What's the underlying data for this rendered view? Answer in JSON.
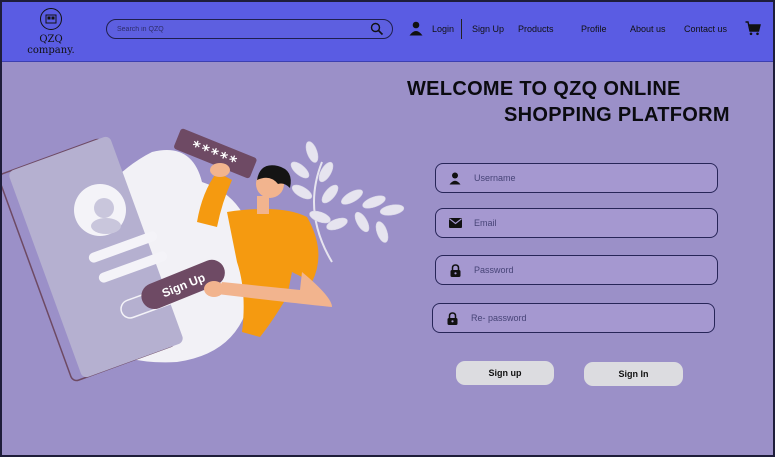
{
  "header": {
    "brand": "QZQ company.",
    "search_placeholder": "Search in QZQ",
    "nav": {
      "login": "Login",
      "signup": "Sign Up",
      "products": "Products",
      "profile": "Profile",
      "about": "About us",
      "contact": "Contact us"
    }
  },
  "hero": {
    "title_line1": "WELCOME TO QZQ ONLINE",
    "title_line2": "SHOPPING PLATFORM",
    "illustration_badge": "Sign Up",
    "password_stars": "*****"
  },
  "form": {
    "username_placeholder": "Username",
    "email_placeholder": "Email",
    "password_placeholder": "Password",
    "repassword_placeholder": "Re- password",
    "signup_button": "Sign up",
    "signin_button": "Sign In"
  },
  "colors": {
    "header_bg": "#5a5ce3",
    "page_bg": "#9b90c8",
    "field_bg": "#a598d0",
    "button_bg": "#dcdce0",
    "accent_orange": "#f59a10",
    "accent_mauve": "#6e4a64"
  },
  "icons": [
    "store-icon",
    "search-icon",
    "user-icon",
    "cart-icon",
    "person-icon",
    "mail-icon",
    "lock-icon"
  ]
}
